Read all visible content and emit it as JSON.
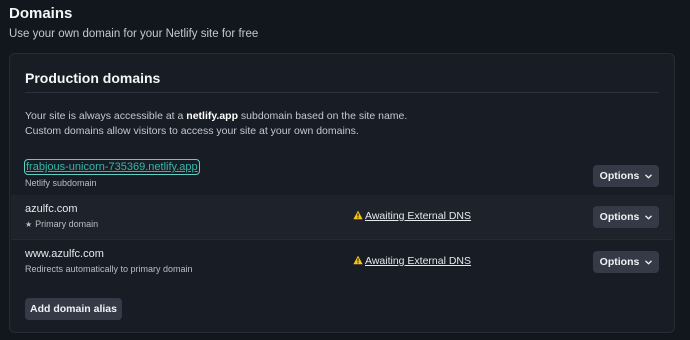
{
  "header": {
    "title": "Domains",
    "subtitle": "Use your own domain for your Netlify site for free"
  },
  "card": {
    "title": "Production domains",
    "description_pre": "Your site is always accessible at a ",
    "description_bold": "netlify.app",
    "description_post": " subdomain based on the site name. Custom domains allow visitors to access your site at your own domains.",
    "add_button_label": "Add domain alias"
  },
  "domains": [
    {
      "name": "frabjous-unicorn-735369.netlify.app",
      "subtitle": "Netlify subdomain",
      "status": "",
      "options_label": "Options"
    },
    {
      "name": "azulfc.com",
      "subtitle": "Primary domain",
      "status": "Awaiting External DNS",
      "options_label": "Options"
    },
    {
      "name": "www.azulfc.com",
      "subtitle": "Redirects automatically to primary domain",
      "status": "Awaiting External DNS",
      "options_label": "Options"
    }
  ],
  "colors": {
    "background": "#12171e",
    "card": "#181d25",
    "link": "#35b7a8",
    "button": "#343b46",
    "warning": "#f5c518"
  },
  "icons": {
    "primary": "star-icon",
    "status": "warning-icon",
    "options": "chevron-down-icon"
  }
}
